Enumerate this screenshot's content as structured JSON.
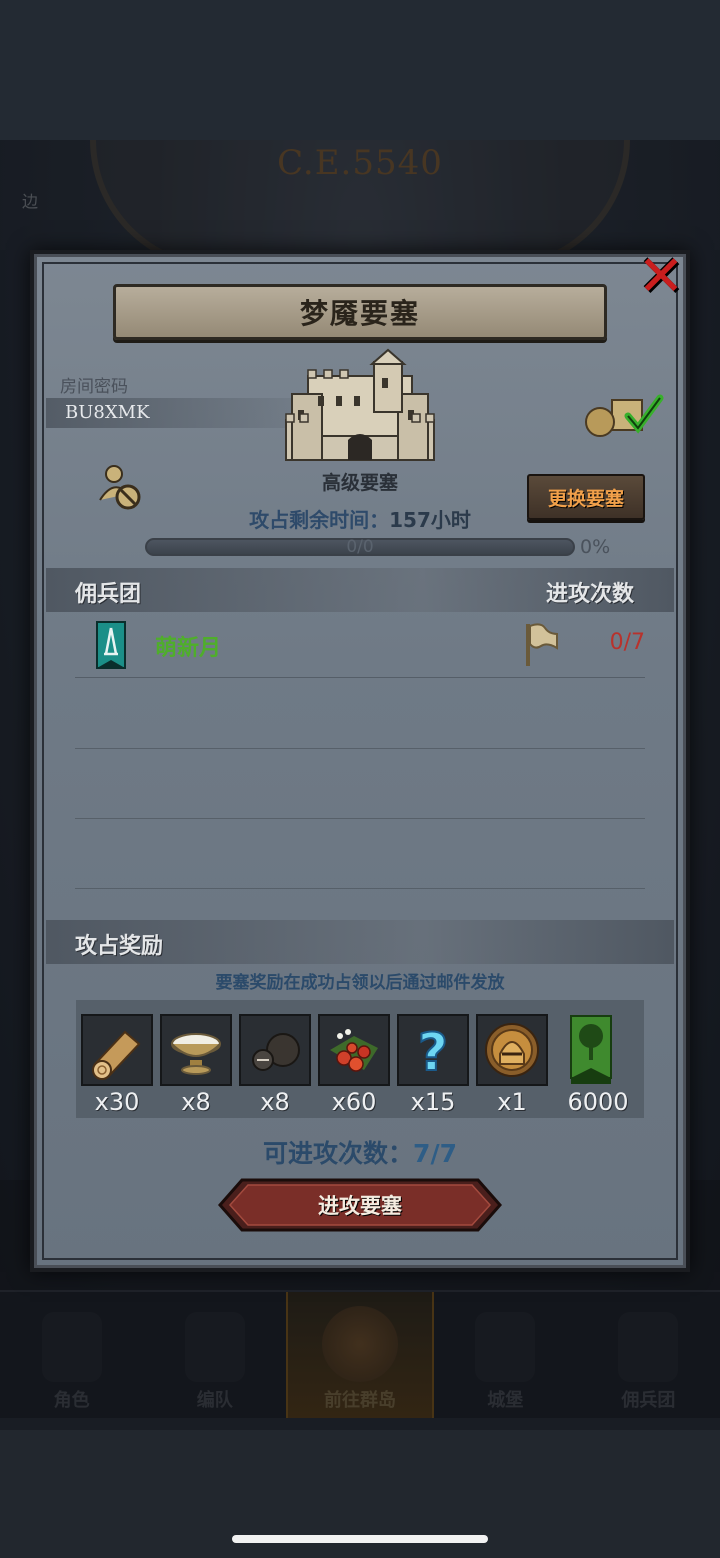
{
  "background": {
    "year_display": "C.E.5540",
    "side_text": "边"
  },
  "modal": {
    "title": "梦魇要塞",
    "room": {
      "label": "房间密码",
      "code": "BU8XMK"
    },
    "fortress": {
      "name": "高级要塞",
      "change_button": "更换要塞"
    },
    "remaining": {
      "label": "攻占剩余时间：",
      "value": "157",
      "unit": "小时"
    },
    "progress": {
      "text": "0/0",
      "percent_label": "0%",
      "fraction": 0
    },
    "mercenary_section": {
      "title": "佣兵团",
      "attack_count_header": "进攻次数"
    },
    "mercenaries": [
      {
        "name": "萌新月",
        "attacks": "0/7"
      }
    ],
    "rewards_section": {
      "title": "攻占奖励",
      "note": "要塞奖励在成功占领以后通过邮件发放"
    },
    "rewards": [
      {
        "icon": "wood-log-icon",
        "qty": "x30"
      },
      {
        "icon": "milk-bowl-icon",
        "qty": "x8"
      },
      {
        "icon": "truffle-icon",
        "qty": "x8"
      },
      {
        "icon": "berries-icon",
        "qty": "x60"
      },
      {
        "icon": "mystery-question-icon",
        "qty": "x15"
      },
      {
        "icon": "golden-helmet-icon",
        "qty": "x1"
      },
      {
        "icon": "guild-banner-tree-icon",
        "qty": "6000"
      }
    ],
    "attacks_available": {
      "label": "可进攻次数：",
      "value": "7/7"
    },
    "attack_button": "进攻要塞"
  },
  "bottom_nav": [
    {
      "label": "角色",
      "active": false
    },
    {
      "label": "编队",
      "active": false
    },
    {
      "label": "前往群岛",
      "active": true
    },
    {
      "label": "城堡",
      "active": false
    },
    {
      "label": "佣兵团",
      "active": false
    }
  ],
  "colors": {
    "accent_orange": "#f1a04a",
    "merc_name_green": "#4fae2b",
    "count_red": "#b8322c",
    "close_red": "#c91e1e"
  }
}
